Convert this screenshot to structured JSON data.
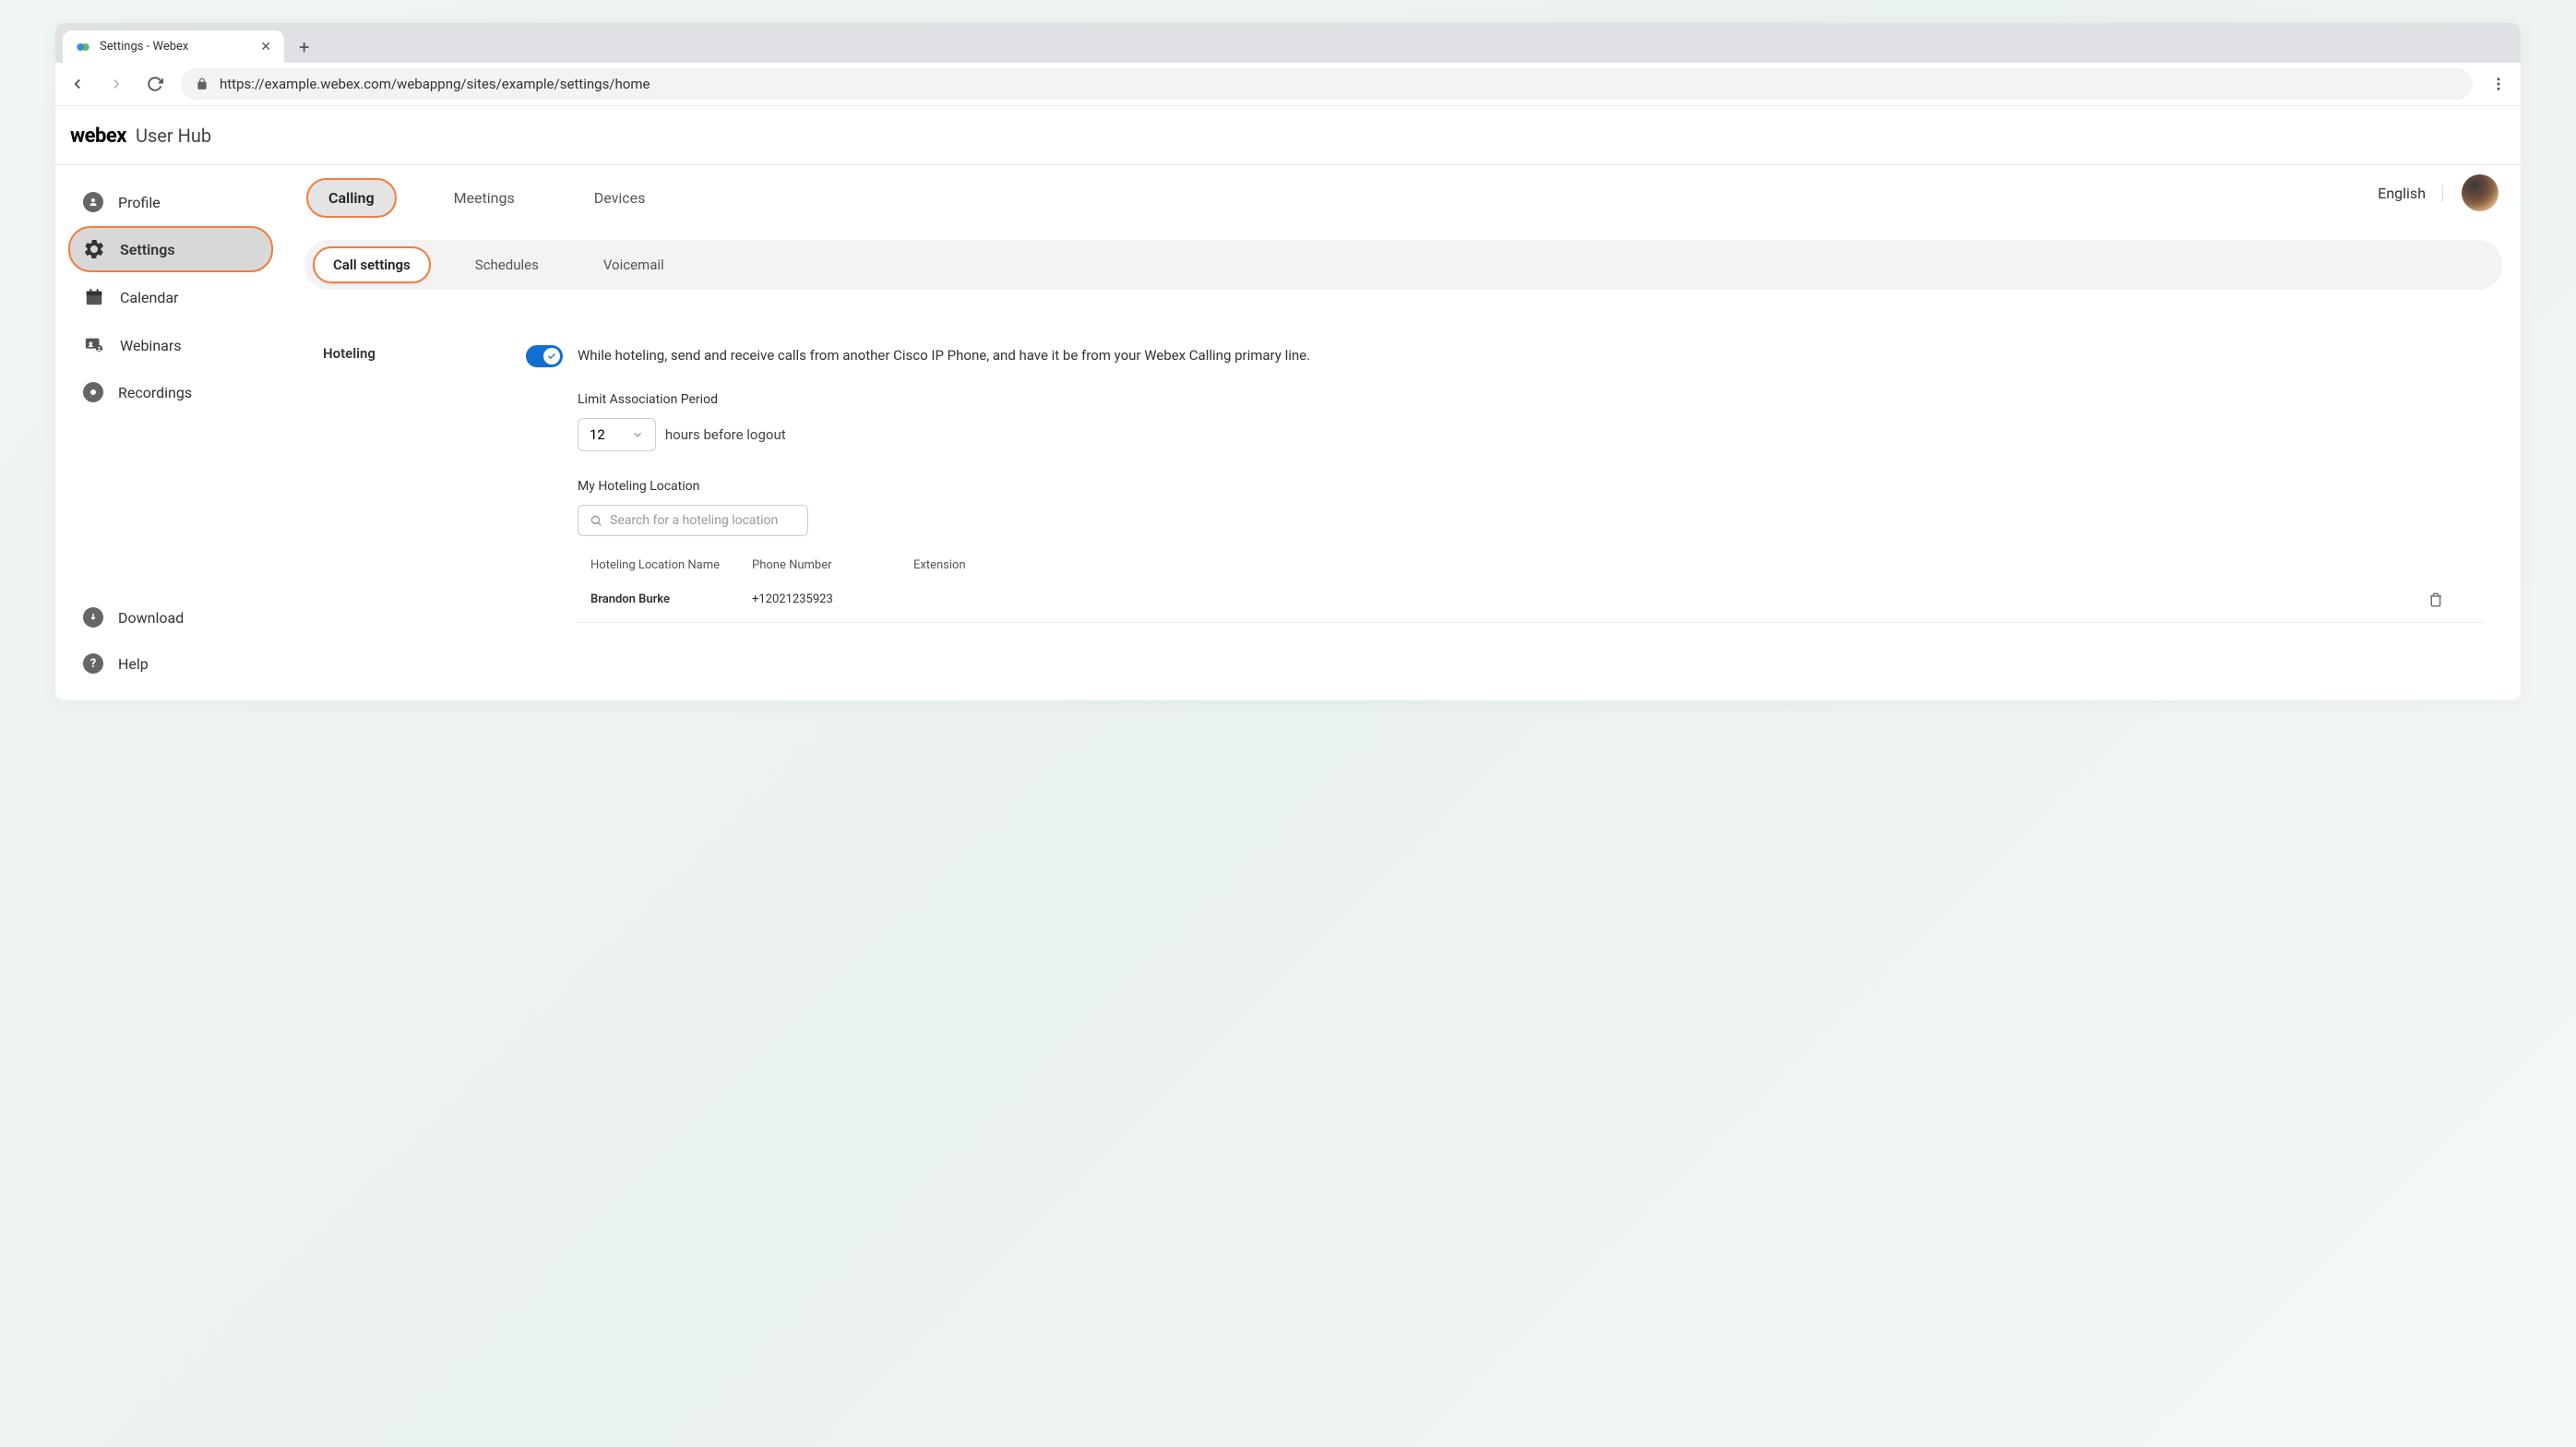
{
  "browser": {
    "tab_title": "Settings - Webex",
    "url": "https://example.webex.com/webappng/sites/example/settings/home"
  },
  "header": {
    "brand": "webex",
    "hub": "User Hub"
  },
  "top_right": {
    "language": "English"
  },
  "sidebar": {
    "items": [
      {
        "label": "Profile"
      },
      {
        "label": "Settings"
      },
      {
        "label": "Calendar"
      },
      {
        "label": "Webinars"
      },
      {
        "label": "Recordings"
      }
    ],
    "bottom": [
      {
        "label": "Download"
      },
      {
        "label": "Help"
      }
    ]
  },
  "tabs": {
    "items": [
      {
        "label": "Calling"
      },
      {
        "label": "Meetings"
      },
      {
        "label": "Devices"
      }
    ]
  },
  "subtabs": {
    "items": [
      {
        "label": "Call settings"
      },
      {
        "label": "Schedules"
      },
      {
        "label": "Voicemail"
      }
    ]
  },
  "hoteling": {
    "section_label": "Hoteling",
    "description": "While hoteling, send and receive calls from another Cisco IP Phone, and have it be from your Webex Calling primary line.",
    "limit_label": "Limit Association Period",
    "limit_value": "12",
    "limit_suffix": "hours before logout",
    "location_label": "My Hoteling Location",
    "search_placeholder": "Search for a hoteling location",
    "table": {
      "col_name": "Hoteling Location Name",
      "col_phone": "Phone Number",
      "col_ext": "Extension",
      "rows": [
        {
          "name": "Brandon Burke",
          "phone": "+12021235923",
          "ext": ""
        }
      ]
    }
  }
}
